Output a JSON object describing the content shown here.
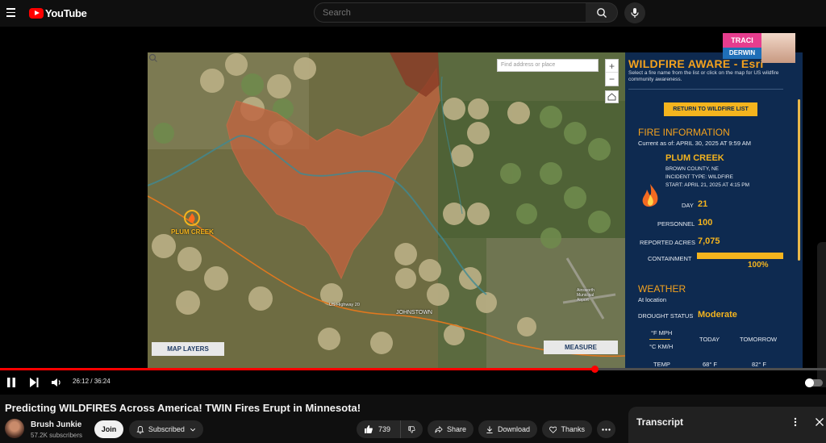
{
  "header": {
    "logo_text": "YouTube",
    "search_placeholder": "Search"
  },
  "video_frame": {
    "map": {
      "search_placeholder": "Find address or place",
      "zoom_in": "+",
      "zoom_out": "−",
      "labels": {
        "fire_marker": "PLUM CREEK",
        "town": "JOHNSTOWN",
        "road": "US Highway 20",
        "airport": "Ainsworth Municipal Airport"
      },
      "layers_button": "MAP LAYERS",
      "measure_button": "MEASURE"
    },
    "panel": {
      "title": "WILDFIRE AWARE - Esri",
      "subtitle": "Select a fire name from the list or click on the map for US wildfire community awareness.",
      "return_button": "RETURN TO WILDFIRE LIST",
      "fire_info_heading": "FIRE INFORMATION",
      "current_as_of": "Current as of: APRIL 30, 2025 AT 9:59 AM",
      "fire_name": "PLUM CREEK",
      "county": "BROWN COUNTY, NE",
      "incident_type": "INCIDENT TYPE: WILDFIRE",
      "start": "START: APRIL 21, 2025 AT 4:15 PM",
      "day_label": "DAY",
      "day_value": "21",
      "personnel_label": "PERSONNEL",
      "personnel_value": "100",
      "acres_label": "REPORTED ACRES",
      "acres_value": "7,075",
      "containment_label": "CONTAINMENT",
      "containment_value": "100%",
      "containment_fraction": 1.0,
      "weather_heading": "WEATHER",
      "at_location": "At location",
      "drought_label": "DROUGHT STATUS",
      "drought_value": "Moderate",
      "unit_f": "°F MPH",
      "unit_c": "°C KM/H",
      "today": "TODAY",
      "tomorrow": "TOMORROW",
      "temp_label": "TEMP",
      "temp_today": "68° F",
      "temp_tomorrow": "82° F"
    },
    "presenter": {
      "first_name": "TRACI",
      "last_name": "DERWIN"
    }
  },
  "player": {
    "current_time": "26:12",
    "duration": "36:24",
    "time_display": "26:12 / 36:24",
    "progress_fraction": 0.7198
  },
  "video_info": {
    "title": "Predicting WILDFIRES Across America! TWIN Fires Erupt in Minnesota!",
    "channel_name": "Brush Junkie",
    "subscribers": "57.2K subscribers",
    "join_label": "Join",
    "subscribed_label": "Subscribed",
    "like_count": "739",
    "share_label": "Share",
    "download_label": "Download",
    "thanks_label": "Thanks"
  },
  "transcript": {
    "title": "Transcript"
  },
  "colors": {
    "brand_red": "#ff0000",
    "panel_navy": "#0e2a50",
    "accent_orange": "#f4a21e",
    "burn_area": "#c0633f"
  }
}
